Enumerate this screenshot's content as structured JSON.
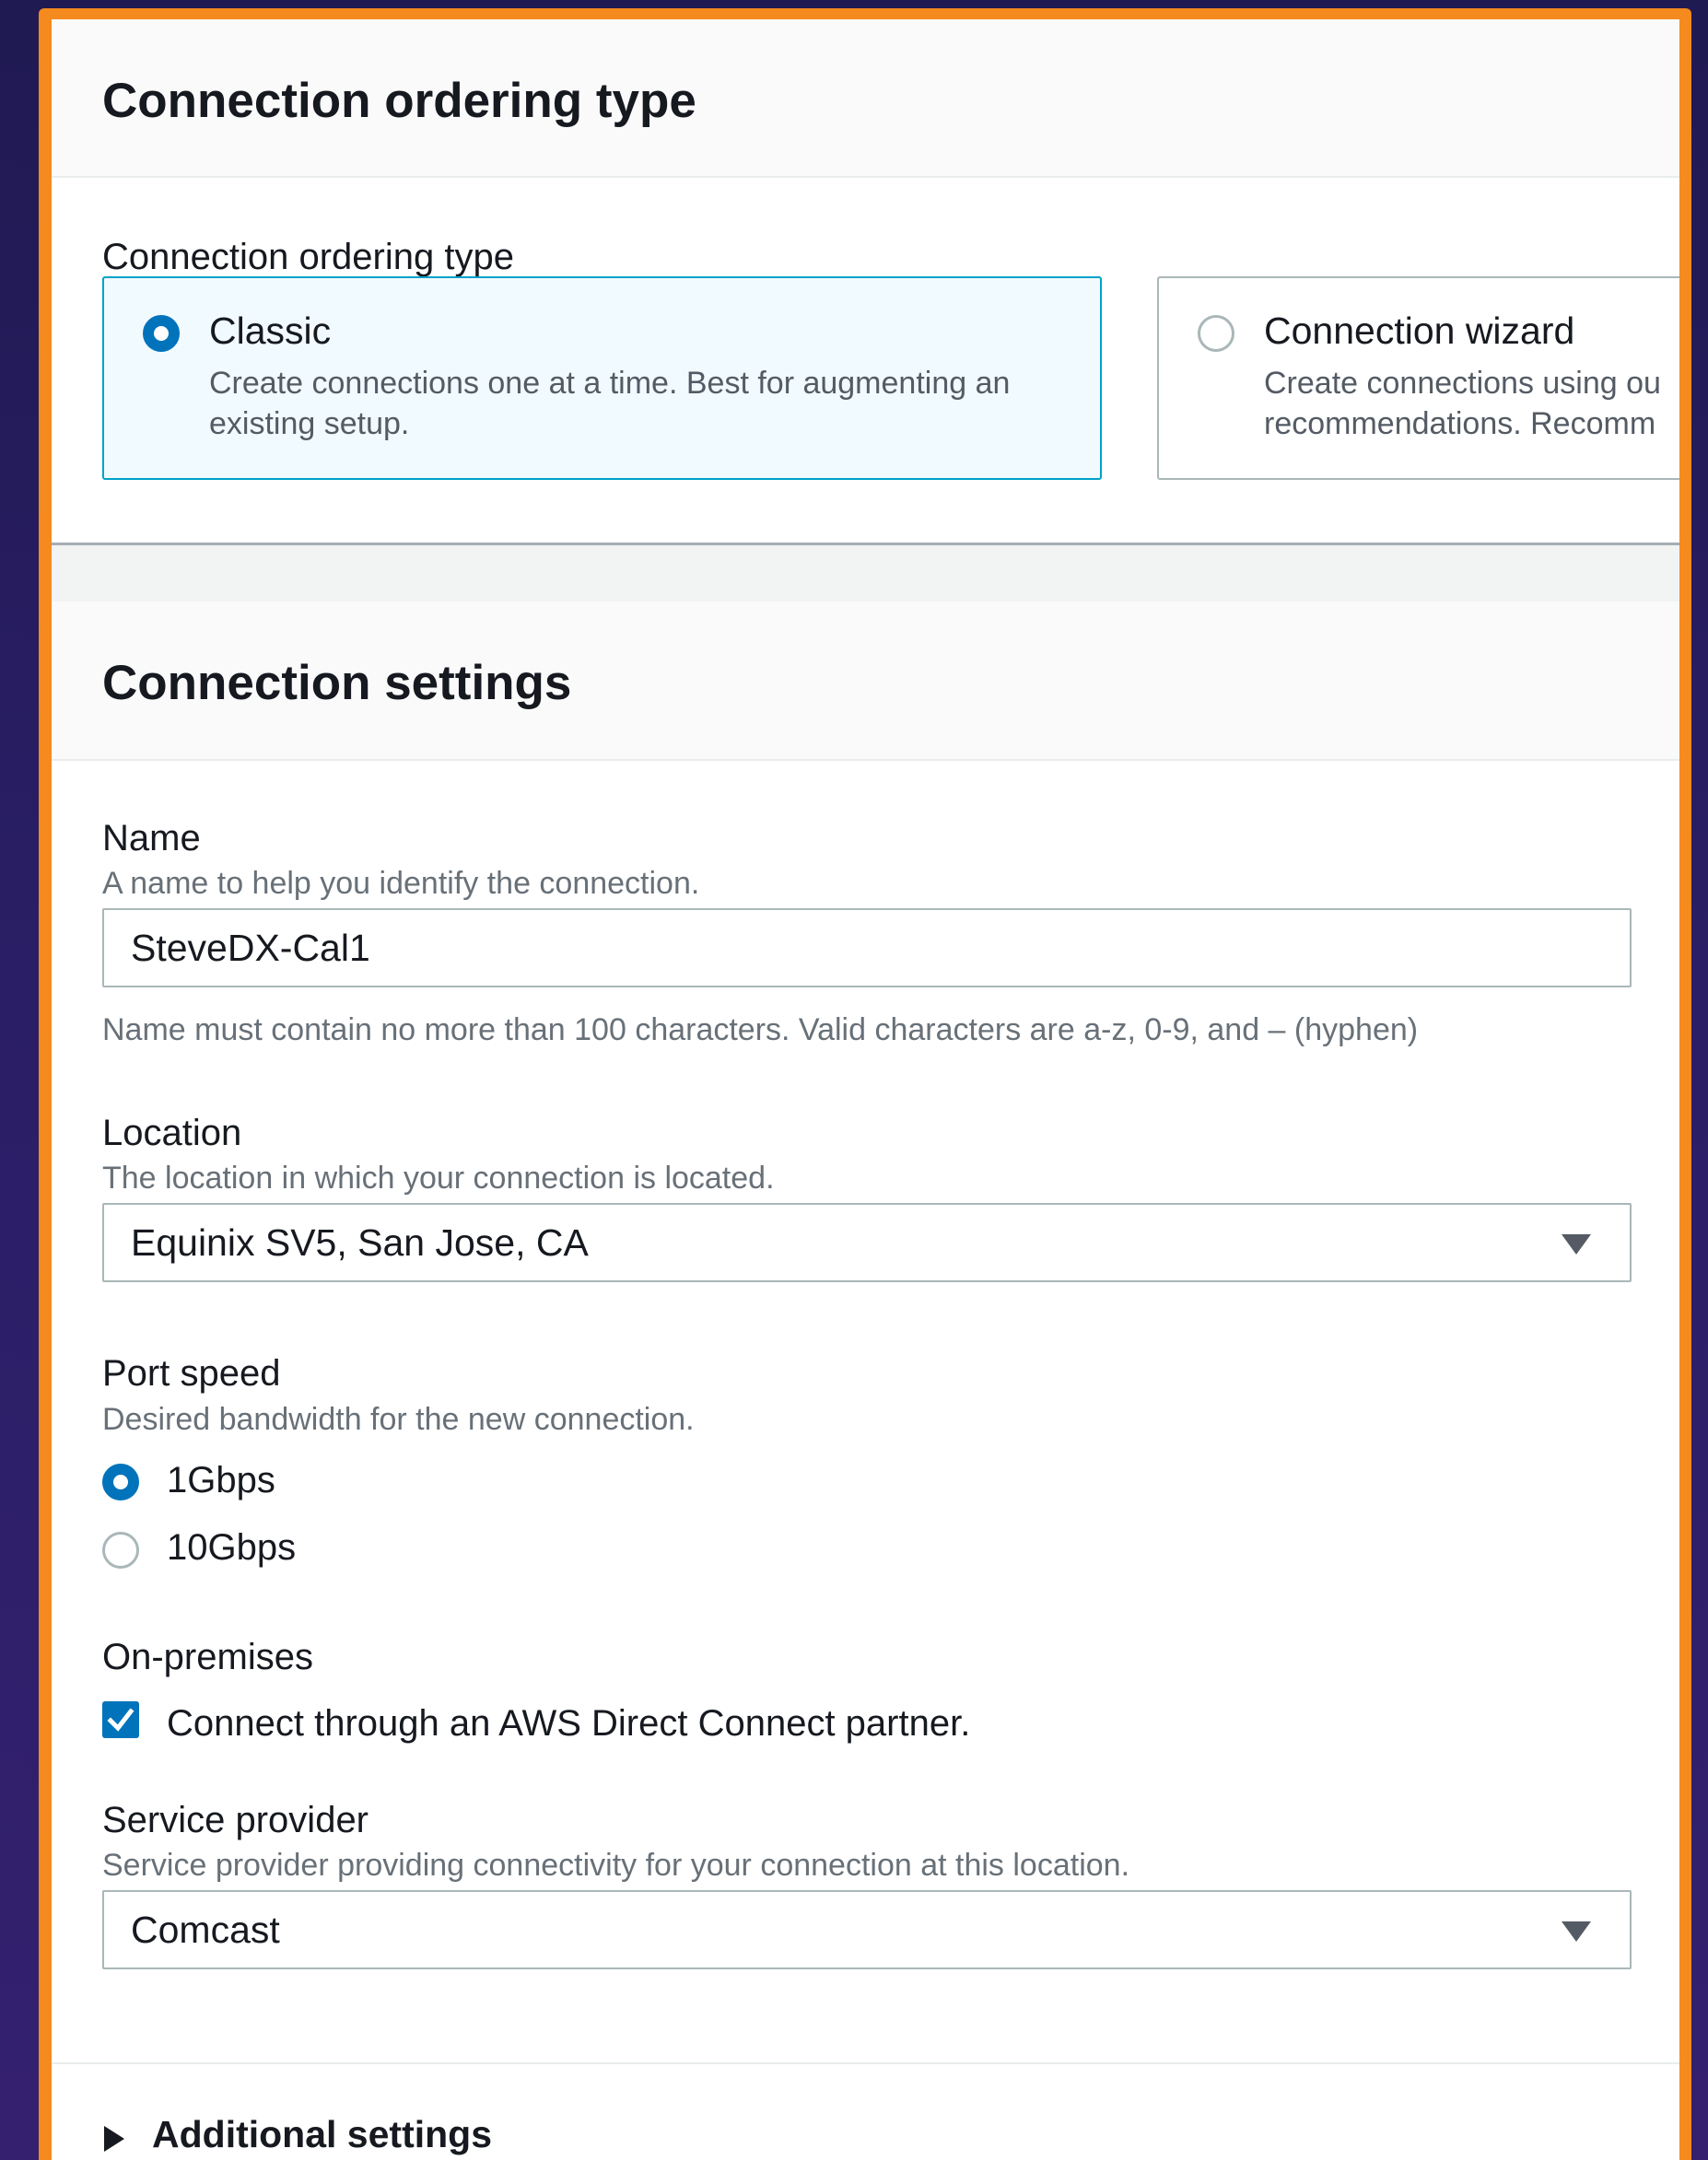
{
  "ordering_card": {
    "title": "Connection ordering type",
    "field_label": "Connection ordering type",
    "options": [
      {
        "title": "Classic",
        "description": "Create connections one at a time. Best for augmenting an existing setup.",
        "selected": true
      },
      {
        "title": "Connection wizard",
        "description_lines": [
          "Create connections using ou",
          "recommendations. Recomm"
        ],
        "selected": false
      }
    ]
  },
  "settings_card": {
    "title": "Connection settings",
    "name": {
      "label": "Name",
      "description": "A name to help you identify the connection.",
      "value": "SteveDX-Cal1",
      "constraint": "Name must contain no more than 100 characters. Valid characters are a-z, 0-9, and – (hyphen)"
    },
    "location": {
      "label": "Location",
      "description": "The location in which your connection is located.",
      "value": "Equinix SV5, San Jose, CA"
    },
    "port_speed": {
      "label": "Port speed",
      "description": "Desired bandwidth for the new connection.",
      "options": [
        {
          "label": "1Gbps",
          "selected": true
        },
        {
          "label": "10Gbps",
          "selected": false
        }
      ]
    },
    "on_premises": {
      "label": "On-premises",
      "checkbox_label": "Connect through an AWS Direct Connect partner.",
      "checked": true
    },
    "service_provider": {
      "label": "Service provider",
      "description": "Service provider providing connectivity for your connection at this location.",
      "value": "Comcast"
    },
    "additional_settings_label": "Additional settings"
  },
  "colors": {
    "frame_accent": "#f58a1f",
    "primary_blue": "#0073bb",
    "selected_tile_bg": "#f1faff",
    "selected_tile_border": "#00a1c9",
    "background": "#241c5c"
  }
}
